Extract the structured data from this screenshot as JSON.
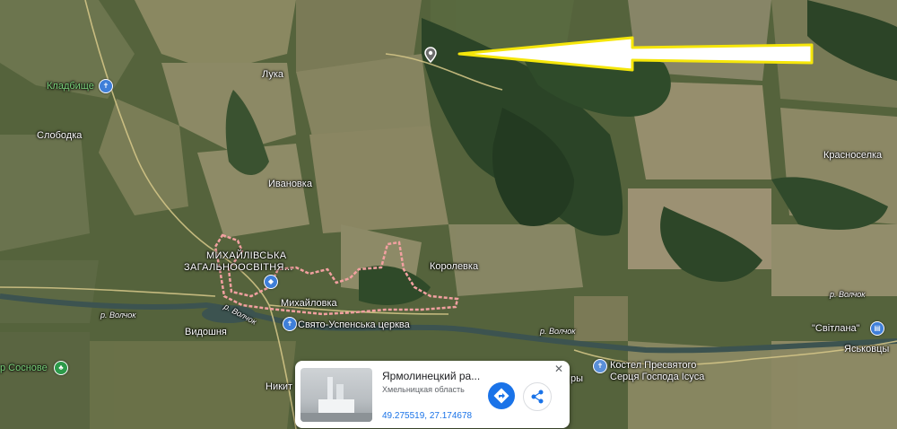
{
  "map": {
    "colors": {
      "base": "#4a5a35",
      "field_light": "#8c8a66",
      "field_tan": "#a39a74",
      "forest_dark": "#22381f",
      "forest": "#2f4a29",
      "river": "#3c5350",
      "road": "#d8c98a",
      "boundary": "#f2a0a0",
      "arrow_fill": "#ffffff",
      "arrow_stroke": "#f5e60a"
    },
    "labels": {
      "kladbische": "Кладбище",
      "sloboda": "Слободка",
      "luka": "Лука",
      "ivanovka": "Ивановка",
      "school_line1": "МИХАЙЛІВСЬКА",
      "school_line2": "ЗАГАЛЬНООСВІТНЯ...",
      "mikhailovka": "Михайловка",
      "korolevka": "Королевка",
      "krasnoselka": "Красноселка",
      "vidoshnya": "Видошня",
      "river1": "р. Волчок",
      "river2": "р. Волчок",
      "river3": "р. Волчок",
      "river4": "р. Волчок",
      "church": "Свято-Успенська церква",
      "svitlana": "\"Світлана\"",
      "yaskovtsy": "Яськовцы",
      "kostel_line1": "Костел Пресвятого",
      "kostel_line2": "Серця Господа Ісуса",
      "sosnove": "р Соснове",
      "nikit": "Никит",
      "partial_ry": "ры"
    },
    "icons": {
      "location_pin": "location-pin-icon",
      "cemetery": "cemetery-icon",
      "school": "school-icon",
      "church": "church-icon",
      "kostel": "church-icon",
      "svitlana": "store-icon",
      "park": "park-icon"
    }
  },
  "info_card": {
    "title": "Ярмолинецкий ра...",
    "subtitle": "Хмельницкая область",
    "coordinates": "49.275519, 27.174678",
    "directions_icon": "directions-icon",
    "share_icon": "share-icon",
    "close_icon": "close-icon"
  }
}
